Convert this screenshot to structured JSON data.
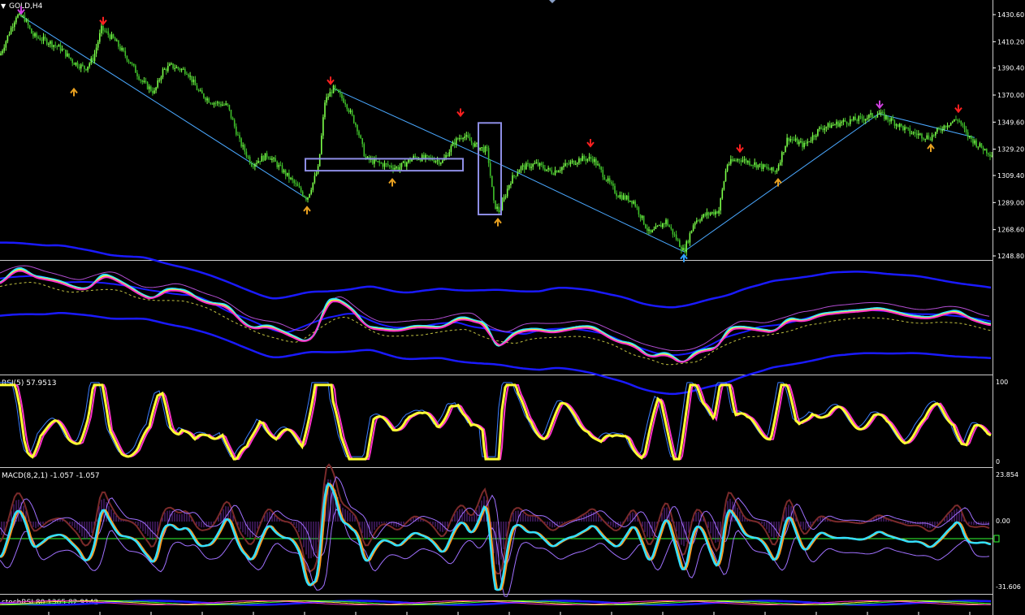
{
  "window": {
    "title": "GOLD,H4",
    "menu_glyph": "▼"
  },
  "colors": {
    "background": "#000000",
    "grid": "#2a2a2a",
    "axis_text": "#ffffff",
    "candle_up": "#7cff4a",
    "candle_down": "#3fbf2a",
    "trendline": "#4aa8ff",
    "box": "#8e8ee6",
    "arrow_red": "#ff2020",
    "arrow_orange": "#e8a020",
    "arrow_magenta": "#d040e0",
    "arrow_blue": "#30a0ff",
    "bands_blue": "#1a1aff",
    "line_cyan": "#33e0ff",
    "line_yellow": "#ffff33",
    "line_magenta": "#ff33cc",
    "line_purple": "#b04cd0",
    "zero_line_green": "#33ff33"
  },
  "panels": {
    "main": {
      "label": "GOLD,H4",
      "y_ticks": [
        "1430.60",
        "1410.20",
        "1390.40",
        "1370.00",
        "1349.60",
        "1329.20",
        "1309.40",
        "1289.00",
        "1268.60",
        "1248.80"
      ]
    },
    "bands": {
      "label": ""
    },
    "rsi": {
      "label": "RSI(5) 57.9513",
      "y_ticks": [
        "100",
        "0"
      ]
    },
    "macd": {
      "label": "MACD(8,2,1) -1.057 -1.057",
      "y_ticks": [
        "23.854",
        "0.00",
        "-31.606"
      ]
    },
    "stochrsi": {
      "label": "stochRSI 80.1365 82.9142"
    }
  },
  "chart_data": {
    "type": "line",
    "symbol": "GOLD",
    "timeframe": "H4",
    "ylim": [
      1248.8,
      1430.6
    ],
    "price_path": [
      [
        0,
        1400
      ],
      [
        20,
        1430
      ],
      [
        30,
        1428
      ],
      [
        40,
        1415
      ],
      [
        60,
        1410
      ],
      [
        75,
        1405
      ],
      [
        90,
        1395
      ],
      [
        105,
        1390
      ],
      [
        115,
        1398
      ],
      [
        125,
        1420
      ],
      [
        140,
        1412
      ],
      [
        160,
        1395
      ],
      [
        175,
        1380
      ],
      [
        190,
        1372
      ],
      [
        200,
        1388
      ],
      [
        210,
        1392
      ],
      [
        230,
        1388
      ],
      [
        245,
        1372
      ],
      [
        260,
        1365
      ],
      [
        280,
        1362
      ],
      [
        295,
        1335
      ],
      [
        310,
        1318
      ],
      [
        330,
        1325
      ],
      [
        345,
        1315
      ],
      [
        360,
        1305
      ],
      [
        378,
        1292
      ],
      [
        392,
        1315
      ],
      [
        400,
        1365
      ],
      [
        410,
        1375
      ],
      [
        425,
        1365
      ],
      [
        440,
        1345
      ],
      [
        450,
        1322
      ],
      [
        470,
        1318
      ],
      [
        490,
        1315
      ],
      [
        510,
        1323
      ],
      [
        530,
        1322
      ],
      [
        545,
        1320
      ],
      [
        560,
        1335
      ],
      [
        570,
        1340
      ],
      [
        585,
        1332
      ],
      [
        600,
        1328
      ],
      [
        608,
        1288
      ],
      [
        615,
        1282
      ],
      [
        628,
        1305
      ],
      [
        640,
        1315
      ],
      [
        660,
        1318
      ],
      [
        680,
        1312
      ],
      [
        700,
        1318
      ],
      [
        715,
        1322
      ],
      [
        730,
        1322
      ],
      [
        745,
        1308
      ],
      [
        760,
        1295
      ],
      [
        780,
        1290
      ],
      [
        800,
        1265
      ],
      [
        820,
        1275
      ],
      [
        842,
        1252
      ],
      [
        855,
        1275
      ],
      [
        870,
        1280
      ],
      [
        885,
        1283
      ],
      [
        895,
        1318
      ],
      [
        910,
        1322
      ],
      [
        930,
        1318
      ],
      [
        955,
        1312
      ],
      [
        970,
        1338
      ],
      [
        990,
        1332
      ],
      [
        1010,
        1345
      ],
      [
        1040,
        1350
      ],
      [
        1060,
        1352
      ],
      [
        1082,
        1356
      ],
      [
        1100,
        1350
      ],
      [
        1120,
        1342
      ],
      [
        1145,
        1338
      ],
      [
        1165,
        1348
      ],
      [
        1180,
        1352
      ],
      [
        1190,
        1340
      ],
      [
        1205,
        1332
      ],
      [
        1222,
        1325
      ]
    ],
    "trendlines": [
      [
        [
          25,
          1430
        ],
        [
          378,
          1292
        ]
      ],
      [
        [
          410,
          1375
        ],
        [
          615,
          1318
        ]
      ],
      [
        [
          615,
          1318
        ],
        [
          842,
          1252
        ]
      ],
      [
        [
          842,
          1252
        ],
        [
          1082,
          1356
        ]
      ],
      [
        [
          1082,
          1356
        ],
        [
          1200,
          1338
        ]
      ]
    ],
    "boxes": [
      {
        "x0": 376,
        "x1": 570,
        "y0": 1322,
        "y1": 1313
      },
      {
        "x0": 589,
        "x1": 617,
        "y0": 1349,
        "y1": 1280
      }
    ],
    "arrows": [
      {
        "x": 26,
        "price": 1432,
        "dir": "down",
        "color": "arrow_magenta"
      },
      {
        "x": 127,
        "price": 1424,
        "dir": "down",
        "color": "arrow_red"
      },
      {
        "x": 91,
        "price": 1374,
        "dir": "up",
        "color": "arrow_orange"
      },
      {
        "x": 378,
        "price": 1285,
        "dir": "up",
        "color": "arrow_orange"
      },
      {
        "x": 407,
        "price": 1379,
        "dir": "down",
        "color": "arrow_red"
      },
      {
        "x": 483,
        "price": 1306,
        "dir": "up",
        "color": "arrow_orange"
      },
      {
        "x": 567,
        "price": 1355,
        "dir": "down",
        "color": "arrow_red"
      },
      {
        "x": 613,
        "price": 1276,
        "dir": "up",
        "color": "arrow_orange"
      },
      {
        "x": 727,
        "price": 1332,
        "dir": "down",
        "color": "arrow_red"
      },
      {
        "x": 842,
        "price": 1249,
        "dir": "up",
        "color": "arrow_blue"
      },
      {
        "x": 911,
        "price": 1328,
        "dir": "down",
        "color": "arrow_red"
      },
      {
        "x": 958,
        "price": 1306,
        "dir": "up",
        "color": "arrow_orange"
      },
      {
        "x": 1083,
        "price": 1361,
        "dir": "down",
        "color": "arrow_magenta"
      },
      {
        "x": 1146,
        "price": 1332,
        "dir": "up",
        "color": "arrow_orange"
      },
      {
        "x": 1180,
        "price": 1358,
        "dir": "down",
        "color": "arrow_red"
      }
    ]
  }
}
